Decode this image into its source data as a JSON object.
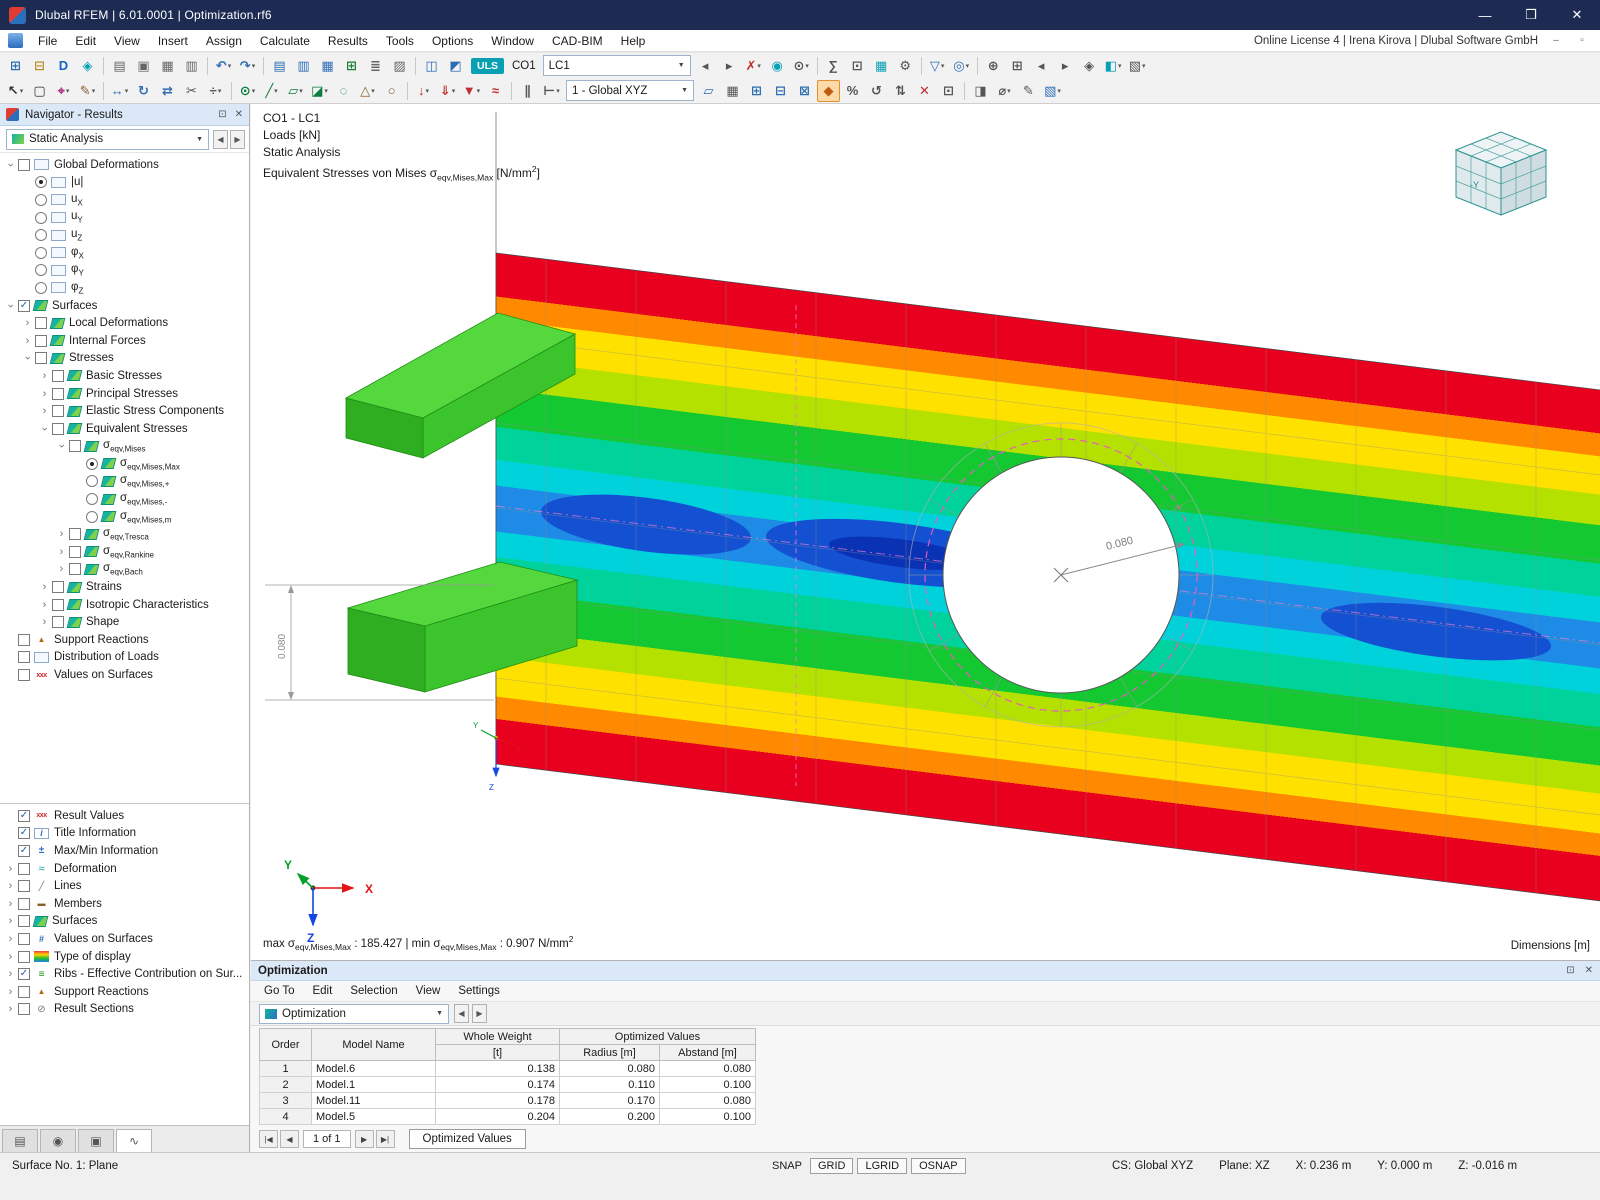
{
  "titlebar": {
    "title": "Dlubal RFEM | 6.01.0001 | Optimization.rf6",
    "minimize": "—",
    "maximize": "❒",
    "close": "✕"
  },
  "menubar": {
    "items": [
      "File",
      "Edit",
      "View",
      "Insert",
      "Assign",
      "Calculate",
      "Results",
      "Tools",
      "Options",
      "Window",
      "CAD-BIM",
      "Help"
    ],
    "license": "Online License 4 | Irena Kirova | Dlubal Software GmbH"
  },
  "toolbar": {
    "uls": "ULS",
    "co1": "CO1",
    "lc1": "LC1",
    "global_xyz": "1 - Global XYZ"
  },
  "toolbar1": [
    {
      "t": "i",
      "n": "new-model",
      "g": "⊞",
      "c": "#2e6db4"
    },
    {
      "t": "i",
      "n": "open-model",
      "g": "⊟",
      "c": "#c09030"
    },
    {
      "t": "i",
      "n": "dlubal-connect",
      "g": "D",
      "c": "#1464c8"
    },
    {
      "t": "i",
      "n": "bim-exchange",
      "g": "◈",
      "c": "#0aa0b4"
    },
    {
      "t": "s"
    },
    {
      "t": "i",
      "n": "printout-report",
      "g": "▤",
      "c": "#666666"
    },
    {
      "t": "i",
      "n": "save",
      "g": "▣",
      "c": "#666666"
    },
    {
      "t": "i",
      "n": "print",
      "g": "▦",
      "c": "#666666"
    },
    {
      "t": "i",
      "n": "clipboard",
      "g": "▥",
      "c": "#666666"
    },
    {
      "t": "s"
    },
    {
      "t": "i",
      "n": "undo",
      "g": "↶",
      "c": "#2e6db4",
      "d": 1
    },
    {
      "t": "i",
      "n": "redo",
      "g": "↷",
      "c": "#2e6db4",
      "d": 1
    },
    {
      "t": "s"
    },
    {
      "t": "i",
      "n": "table-layout-1",
      "g": "▤",
      "c": "#2e6db4"
    },
    {
      "t": "i",
      "n": "table-layout-2",
      "g": "▥",
      "c": "#2e6db4"
    },
    {
      "t": "i",
      "n": "table-layout-3",
      "g": "▦",
      "c": "#2e6db4"
    },
    {
      "t": "i",
      "n": "export-tables",
      "g": "⊞",
      "c": "#1e7e34"
    },
    {
      "t": "i",
      "n": "result-diagram",
      "g": "≣",
      "c": "#666666"
    },
    {
      "t": "i",
      "n": "printout",
      "g": "▨",
      "c": "#666666"
    },
    {
      "t": "s"
    },
    {
      "t": "i",
      "n": "load-cases",
      "g": "◫",
      "c": "#2e6db4"
    },
    {
      "t": "i",
      "n": "load-combinations",
      "g": "◩",
      "c": "#2e6db4"
    },
    {
      "t": "b",
      "n": "design-situation-badge",
      "k": "uls"
    },
    {
      "t": "l",
      "n": "combination-label",
      "k": "co1"
    },
    {
      "t": "c",
      "n": "load-case-combo",
      "k": "lc1",
      "w": 148
    },
    {
      "t": "i",
      "n": "previous-load-case",
      "g": "◂",
      "c": "#555555"
    },
    {
      "t": "i",
      "n": "next-load-case",
      "g": "▸",
      "c": "#555555"
    },
    {
      "t": "i",
      "n": "delete-results",
      "g": "✗",
      "c": "#c03030",
      "d": 1
    },
    {
      "t": "i",
      "n": "show-results",
      "g": "◉",
      "c": "#0aa0b4"
    },
    {
      "t": "i",
      "n": "show-result-values",
      "g": "⊙",
      "c": "#555555",
      "d": 1
    },
    {
      "t": "s"
    },
    {
      "t": "i",
      "n": "result-tables",
      "g": "∑",
      "c": "#555555"
    },
    {
      "t": "i",
      "n": "display-properties",
      "g": "⊡",
      "c": "#555555"
    },
    {
      "t": "i",
      "n": "fe-mesh",
      "g": "▦",
      "c": "#0aa0b4"
    },
    {
      "t": "i",
      "n": "calculate",
      "g": "⚙",
      "c": "#555555"
    },
    {
      "t": "s"
    },
    {
      "t": "i",
      "n": "selection-filter",
      "g": "▽",
      "c": "#2e6db4",
      "d": 1
    },
    {
      "t": "i",
      "n": "visibilities",
      "g": "◎",
      "c": "#2e6db4",
      "d": 1
    },
    {
      "t": "s"
    },
    {
      "t": "i",
      "n": "zoom-in",
      "g": "⊕",
      "c": "#555555"
    },
    {
      "t": "i",
      "n": "zoom-window",
      "g": "⊞",
      "c": "#555555"
    },
    {
      "t": "i",
      "n": "previous-view",
      "g": "◂",
      "c": "#555555"
    },
    {
      "t": "i",
      "n": "next-view",
      "g": "▸",
      "c": "#555555"
    },
    {
      "t": "i",
      "n": "isometric-view",
      "g": "◈",
      "c": "#555555"
    },
    {
      "t": "i",
      "n": "rendering-mode",
      "g": "◧",
      "c": "#0aa0b4",
      "d": 1
    },
    {
      "t": "i",
      "n": "display-options",
      "g": "▧",
      "c": "#555555",
      "d": 1
    }
  ],
  "toolbar2": [
    {
      "t": "i",
      "n": "select-cursor",
      "g": "↖",
      "c": "#333333",
      "d": 1
    },
    {
      "t": "i",
      "n": "select-window",
      "g": "▢",
      "c": "#333333"
    },
    {
      "t": "i",
      "n": "snap-settings",
      "g": "⌖",
      "c": "#b03080",
      "d": 1
    },
    {
      "t": "i",
      "n": "edit-mode",
      "g": "✎",
      "c": "#8a5c2e",
      "d": 1
    },
    {
      "t": "s"
    },
    {
      "t": "i",
      "n": "move-copy",
      "g": "↔",
      "c": "#2e6db4",
      "d": 1
    },
    {
      "t": "i",
      "n": "rotate",
      "g": "↻",
      "c": "#2e6db4"
    },
    {
      "t": "i",
      "n": "mirror",
      "g": "⇄",
      "c": "#2e6db4"
    },
    {
      "t": "i",
      "n": "trim",
      "g": "✂",
      "c": "#555555"
    },
    {
      "t": "i",
      "n": "divide",
      "g": "÷",
      "c": "#555555",
      "d": 1
    },
    {
      "t": "s"
    },
    {
      "t": "i",
      "n": "new-node",
      "g": "⊙",
      "c": "#0a7e3c",
      "d": 1
    },
    {
      "t": "i",
      "n": "new-line",
      "g": "╱",
      "c": "#0a7e3c",
      "d": 1
    },
    {
      "t": "i",
      "n": "new-surface",
      "g": "▱",
      "c": "#0a7e3c",
      "d": 1
    },
    {
      "t": "i",
      "n": "new-solid",
      "g": "◪",
      "c": "#0a7e3c",
      "d": 1
    },
    {
      "t": "i",
      "n": "new-opening",
      "g": "◌",
      "c": "#0a7e3c"
    },
    {
      "t": "i",
      "n": "new-support",
      "g": "△",
      "c": "#8a5c2e",
      "d": 1
    },
    {
      "t": "i",
      "n": "new-hinge",
      "g": "○",
      "c": "#8a5c2e"
    },
    {
      "t": "s"
    },
    {
      "t": "i",
      "n": "nodal-load",
      "g": "↓",
      "c": "#c03030",
      "d": 1
    },
    {
      "t": "i",
      "n": "line-load",
      "g": "⇓",
      "c": "#c03030",
      "d": 1
    },
    {
      "t": "i",
      "n": "surface-load",
      "g": "▼",
      "c": "#c03030",
      "d": 1
    },
    {
      "t": "i",
      "n": "imperfection",
      "g": "≈",
      "c": "#c03030"
    },
    {
      "t": "s"
    },
    {
      "t": "i",
      "n": "guidelines",
      "g": "∥",
      "c": "#555555"
    },
    {
      "t": "i",
      "n": "dimensions-tool",
      "g": "⊢",
      "c": "#555555",
      "d": 1
    },
    {
      "t": "c",
      "n": "coordinate-system-combo",
      "k": "global_xyz",
      "w": 128
    },
    {
      "t": "i",
      "n": "work-plane",
      "g": "▱",
      "c": "#2e6db4"
    },
    {
      "t": "i",
      "n": "grid-settings",
      "g": "▦",
      "c": "#555555"
    },
    {
      "t": "i",
      "n": "plane-xy",
      "g": "⊞",
      "c": "#2e6db4"
    },
    {
      "t": "i",
      "n": "plane-yz",
      "g": "⊟",
      "c": "#2e6db4"
    },
    {
      "t": "i",
      "n": "plane-xz",
      "g": "⊠",
      "c": "#2e6db4"
    },
    {
      "t": "i",
      "n": "snap-active",
      "g": "◆",
      "c": "#c05a10",
      "a": 1
    },
    {
      "t": "i",
      "n": "percent-display",
      "g": "%",
      "c": "#555555"
    },
    {
      "t": "i",
      "n": "rotate-view",
      "g": "↺",
      "c": "#555555"
    },
    {
      "t": "i",
      "n": "flip-view",
      "g": "⇅",
      "c": "#555555"
    },
    {
      "t": "i",
      "n": "cancel-action",
      "g": "✕",
      "c": "#c03030"
    },
    {
      "t": "i",
      "n": "fit-view",
      "g": "⊡",
      "c": "#555555"
    },
    {
      "t": "s"
    },
    {
      "t": "i",
      "n": "clipping-plane",
      "g": "◨",
      "c": "#555555"
    },
    {
      "t": "i",
      "n": "measure",
      "g": "⌀",
      "c": "#555555",
      "d": 1
    },
    {
      "t": "i",
      "n": "notes",
      "g": "✎",
      "c": "#555555"
    },
    {
      "t": "i",
      "n": "color-scale",
      "g": "▧",
      "c": "#2e6db4",
      "d": 1
    }
  ],
  "navigator": {
    "title": "Navigator - Results",
    "analysis_combo": "Static Analysis",
    "tree": [
      {
        "lvl": 0,
        "exp": "v",
        "ctl": "cbx0",
        "icon": "winframe",
        "label": "Global Deformations"
      },
      {
        "lvl": 1,
        "ctl": "rad1",
        "icon": "winframe",
        "label": "|u|"
      },
      {
        "lvl": 1,
        "ctl": "rad0",
        "icon": "winframe",
        "label": "u",
        "sub": "X"
      },
      {
        "lvl": 1,
        "ctl": "rad0",
        "icon": "winframe",
        "label": "u",
        "sub": "Y"
      },
      {
        "lvl": 1,
        "ctl": "rad0",
        "icon": "winframe",
        "label": "u",
        "sub": "Z"
      },
      {
        "lvl": 1,
        "ctl": "rad0",
        "icon": "winframe",
        "label": "φ",
        "sub": "X"
      },
      {
        "lvl": 1,
        "ctl": "rad0",
        "icon": "winframe",
        "label": "φ",
        "sub": "Y"
      },
      {
        "lvl": 1,
        "ctl": "rad0",
        "icon": "winframe",
        "label": "φ",
        "sub": "Z"
      },
      {
        "lvl": 0,
        "exp": "v",
        "ctl": "cbx1",
        "icon": "surface",
        "label": "Surfaces"
      },
      {
        "lvl": 1,
        "exp": "r",
        "ctl": "cbx0",
        "icon": "surface",
        "label": "Local Deformations"
      },
      {
        "lvl": 1,
        "exp": "r",
        "ctl": "cbx0",
        "icon": "surface",
        "label": "Internal Forces"
      },
      {
        "lvl": 1,
        "exp": "v",
        "ctl": "cbx0",
        "icon": "surface",
        "label": "Stresses"
      },
      {
        "lvl": 2,
        "exp": "r",
        "ctl": "cbx0",
        "icon": "surface",
        "label": "Basic Stresses"
      },
      {
        "lvl": 2,
        "exp": "r",
        "ctl": "cbx0",
        "icon": "surface",
        "label": "Principal Stresses"
      },
      {
        "lvl": 2,
        "exp": "r",
        "ctl": "cbx0",
        "icon": "surface",
        "label": "Elastic Stress Components"
      },
      {
        "lvl": 2,
        "exp": "v",
        "ctl": "cbx0",
        "icon": "surface",
        "label": "Equivalent Stresses"
      },
      {
        "lvl": 3,
        "exp": "v",
        "ctl": "cbx0",
        "icon": "surface",
        "label": "σ",
        "sub": "eqv,Mises"
      },
      {
        "lvl": 4,
        "ctl": "rad1",
        "icon": "surface",
        "label": "σ",
        "sub": "eqv,Mises,Max"
      },
      {
        "lvl": 4,
        "ctl": "rad0",
        "icon": "surface",
        "label": "σ",
        "sub": "eqv,Mises,+"
      },
      {
        "lvl": 4,
        "ctl": "rad0",
        "icon": "surface",
        "label": "σ",
        "sub": "eqv,Mises,-"
      },
      {
        "lvl": 4,
        "ctl": "rad0",
        "icon": "surface",
        "label": "σ",
        "sub": "eqv,Mises,m"
      },
      {
        "lvl": 3,
        "exp": "r",
        "ctl": "cbx0",
        "icon": "surface",
        "label": "σ",
        "sub": "eqv,Tresca"
      },
      {
        "lvl": 3,
        "exp": "r",
        "ctl": "cbx0",
        "icon": "surface",
        "label": "σ",
        "sub": "eqv,Rankine"
      },
      {
        "lvl": 3,
        "exp": "r",
        "ctl": "cbx0",
        "icon": "surface",
        "label": "σ",
        "sub": "eqv,Bach"
      },
      {
        "lvl": 2,
        "exp": "r",
        "ctl": "cbx0",
        "icon": "surface",
        "label": "Strains"
      },
      {
        "lvl": 2,
        "exp": "r",
        "ctl": "cbx0",
        "icon": "surface",
        "label": "Isotropic Characteristics"
      },
      {
        "lvl": 2,
        "exp": "r",
        "ctl": "cbx0",
        "icon": "surface",
        "label": "Shape"
      },
      {
        "lvl": 0,
        "ctl": "cbx0",
        "icon": "support",
        "label": "Support Reactions"
      },
      {
        "lvl": 0,
        "ctl": "cbx0",
        "icon": "winframe",
        "label": "Distribution of Loads"
      },
      {
        "lvl": 0,
        "ctl": "cbx0",
        "icon": "xxx",
        "label": "Values on Surfaces"
      }
    ],
    "tree2": [
      {
        "lvl": 0,
        "ctl": "cbx1",
        "icon": "xxx",
        "label": "Result Values"
      },
      {
        "lvl": 0,
        "ctl": "cbx1",
        "icon": "info",
        "label": "Title Information"
      },
      {
        "lvl": 0,
        "ctl": "cbx1",
        "icon": "maxmin",
        "label": "Max/Min Information"
      },
      {
        "lvl": 0,
        "exp": "r",
        "ctl": "cbx0",
        "icon": "deform",
        "label": "Deformation"
      },
      {
        "lvl": 0,
        "exp": "r",
        "ctl": "cbx0",
        "icon": "lines",
        "label": "Lines"
      },
      {
        "lvl": 0,
        "exp": "r",
        "ctl": "cbx0",
        "icon": "members",
        "label": "Members"
      },
      {
        "lvl": 0,
        "exp": "r",
        "ctl": "cbx0",
        "icon": "surface",
        "label": "Surfaces"
      },
      {
        "lvl": 0,
        "exp": "r",
        "ctl": "cbx0",
        "icon": "values",
        "label": "Values on Surfaces"
      },
      {
        "lvl": 0,
        "exp": "r",
        "ctl": "cbx0",
        "icon": "display",
        "label": "Type of display"
      },
      {
        "lvl": 0,
        "exp": "r",
        "ctl": "cbx1",
        "icon": "ribs",
        "label": "Ribs - Effective Contribution on Sur..."
      },
      {
        "lvl": 0,
        "exp": "r",
        "ctl": "cbx0",
        "icon": "support",
        "label": "Support Reactions"
      },
      {
        "lvl": 0,
        "exp": "r",
        "ctl": "cbx0",
        "icon": "sections",
        "label": "Result Sections"
      }
    ],
    "bottom_tabs": [
      {
        "n": "tab-data",
        "g": "▤"
      },
      {
        "n": "tab-views",
        "g": "◉"
      },
      {
        "n": "tab-camera",
        "g": "▣"
      },
      {
        "n": "tab-results-chart",
        "g": "∿",
        "active": 1
      }
    ]
  },
  "viewport": {
    "combo_line": "CO1 - LC1",
    "loads_line": "Loads [kN]",
    "analysis_line": "Static Analysis",
    "stress_prefix": "Equivalent Stresses von Mises σ",
    "stress_sub": "eqv,Mises,Max",
    "stress_unit_pre": " [N/mm",
    "stress_unit_sup": "2",
    "stress_unit_post": "]",
    "max_pre": "max σ",
    "max_sub": "eqv,Mises,Max",
    "max_mid": " : 185.427 | min σ",
    "min_sub": "eqv,Mises,Max",
    "min_post": " : 0.907 N/mm",
    "min_sup": "2",
    "dimensions_label": "Dimensions [m]",
    "hole_dim": "0.080",
    "left_dim": "0.080",
    "axis_x": "X",
    "axis_y": "Y",
    "axis_z": "Z",
    "cube_label": "-Y"
  },
  "optimization": {
    "title": "Optimization",
    "float_icon": "⊡",
    "close_icon": "✕",
    "menu": [
      "Go To",
      "Edit",
      "Selection",
      "View",
      "Settings"
    ],
    "combo": "Optimization",
    "columns": {
      "order": "Order",
      "model": "Model Name",
      "weight1": "Whole Weight",
      "weight2": "[t]",
      "optimized": "Optimized Values",
      "radius": "Radius [m]",
      "abstand": "Abstand [m]"
    },
    "rows": [
      [
        "1",
        "Model.6",
        "0.138",
        "0.080",
        "0.080"
      ],
      [
        "2",
        "Model.1",
        "0.174",
        "0.110",
        "0.100"
      ],
      [
        "3",
        "Model.11",
        "0.178",
        "0.170",
        "0.080"
      ],
      [
        "4",
        "Model.5",
        "0.204",
        "0.200",
        "0.100"
      ]
    ],
    "pagination": {
      "first": "|◀",
      "prev": "◀",
      "label": "1 of 1",
      "next": "▶",
      "last": "▶|"
    },
    "tab": "Optimized Values"
  },
  "statusbar": {
    "surface": "Surface No. 1: Plane",
    "snap": "SNAP",
    "grid": "GRID",
    "lgrid": "LGRID",
    "osnap": "OSNAP",
    "cs": "CS: Global XYZ",
    "plane": "Plane: XZ",
    "x": "X: 0.236 m",
    "y": "Y: 0.000 m",
    "z": "Z: -0.016 m"
  }
}
